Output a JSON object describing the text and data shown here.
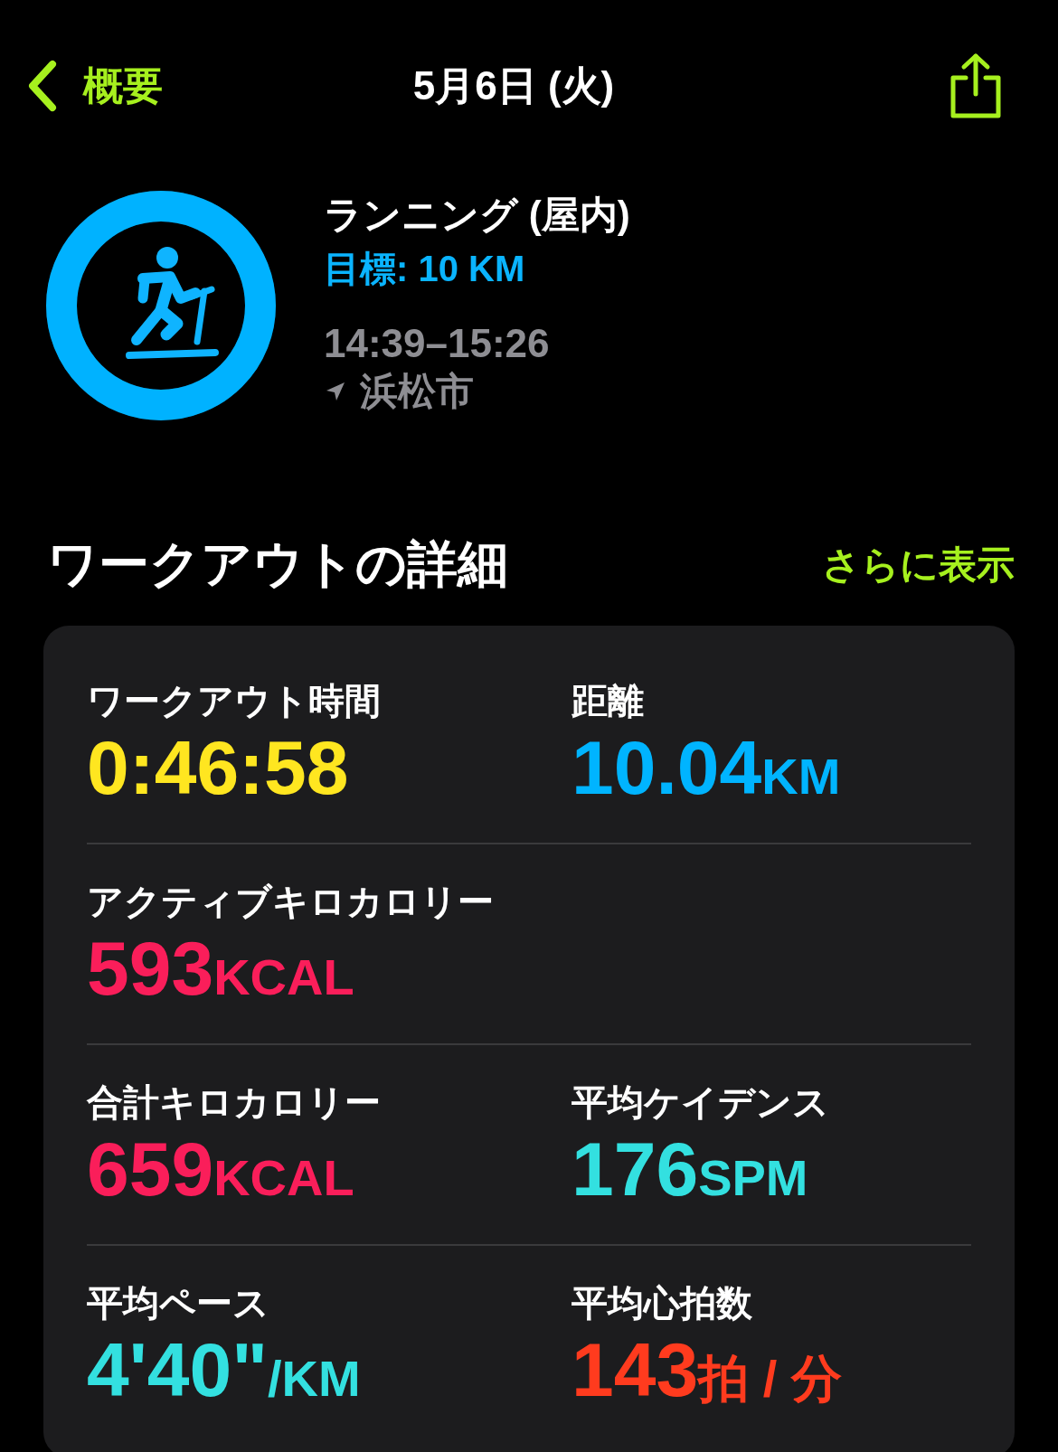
{
  "nav": {
    "back": "概要",
    "title": "5月6日 (火)"
  },
  "workout": {
    "name": "ランニング (屋内)",
    "goal": "目標: 10 KM",
    "level": 1,
    "time": "14:39–15:26",
    "location": "浜松市"
  },
  "details": {
    "title": "ワークアウトの詳細",
    "more": "さらに表示",
    "rows": [
      [
        {
          "label": "ワークアウト時間",
          "value": "0:46:58",
          "color": "#ffe620"
        },
        {
          "label": "距離",
          "value": "10.04",
          "unit": "KM",
          "color": "#00b4ff"
        }
      ],
      [
        {
          "label": "アクティブキロカロリー",
          "value": "593",
          "unit": "KCAL",
          "color": "#fa1e5a"
        }
      ],
      [
        {
          "label": "合計キロカロリー",
          "value": "659",
          "unit": "KCAL",
          "color": "#fa1e5a"
        },
        {
          "label": "平均ケイデンス",
          "value": "176",
          "unit": "SPM",
          "color": "#33e0e0"
        }
      ],
      [
        {
          "label": "平均ペース",
          "value": "4'40\"",
          "unit": "/KM",
          "color": "#33e0e0"
        },
        {
          "label": "平均心拍数",
          "value": "143",
          "unit": "拍 / 分",
          "color": "#ff3b1e"
        }
      ]
    ]
  }
}
